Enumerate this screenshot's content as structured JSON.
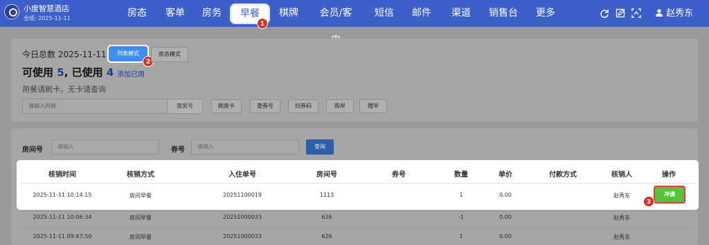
{
  "app": {
    "hotel_name": "小度智慧酒店",
    "hotel_sub": "全班: 2025-11-11",
    "user": "赵秀东"
  },
  "nav": [
    {
      "label": "房态"
    },
    {
      "label": "客单"
    },
    {
      "label": "房务"
    },
    {
      "label": "早餐"
    },
    {
      "label": "棋牌"
    },
    {
      "label": "会员/客史"
    },
    {
      "label": "短信"
    },
    {
      "label": "邮件"
    },
    {
      "label": "渠道"
    },
    {
      "label": "销售台"
    },
    {
      "label": "更多"
    }
  ],
  "badges": [
    "1",
    "2",
    "3"
  ],
  "summary": {
    "title": "今日总数 2025-11-11",
    "list_mode": "列表模式",
    "room_mode": "房态模式",
    "available_label": "可使用",
    "available": "5",
    "used_label": ", 已使用",
    "used": "4",
    "add_used": "添加已用",
    "hint": "用餐请刷卡，无卡请查询",
    "search_placeholder": "请输入内容",
    "query": "查房号",
    "buttons": [
      "刷房卡",
      "查券号",
      "扫券码",
      "购早",
      "赠早"
    ]
  },
  "filter": {
    "room_label": "房间号",
    "room_placeholder": "请输入",
    "voucher_label": "券号",
    "voucher_placeholder": "请输入",
    "query": "查询"
  },
  "table": {
    "headers": [
      "核销时间",
      "核销方式",
      "入住单号",
      "房间号",
      "券号",
      "数量",
      "单价",
      "付款方式",
      "核销人",
      "操作"
    ],
    "rows": [
      {
        "time": "2025-11-11 10:14:15",
        "method": "房间早餐",
        "order": "20251100019",
        "room": "1113",
        "voucher": "",
        "qty": "1",
        "price": "0.00",
        "pay": "",
        "user": "赵秀东",
        "action": "冲调"
      },
      {
        "time": "2025-11-11 10:06:34",
        "method": "房间早餐",
        "order": "20251000033",
        "room": "626",
        "voucher": "",
        "qty": "-1",
        "price": "0.00",
        "pay": "",
        "user": "赵秀东",
        "action": ""
      },
      {
        "time": "2025-11-11 09:47:50",
        "method": "房间早餐",
        "order": "20251000033",
        "room": "626",
        "voucher": "",
        "qty": "1",
        "price": "0.00",
        "pay": "",
        "user": "赵秀东",
        "action": ""
      }
    ]
  },
  "colors": {
    "brand": "#3d5fc9",
    "primary": "#3d8ef0",
    "success": "#57c23a",
    "highlight": "#e53a3a",
    "badge": "#d8322c"
  }
}
